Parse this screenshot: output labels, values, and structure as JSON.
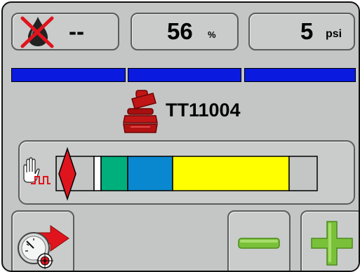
{
  "flow_tile": {
    "value": "--",
    "icon": "no-flow-drop-icon"
  },
  "percent_tile": {
    "value": "56",
    "unit": "%"
  },
  "pressure_tile": {
    "value": "5",
    "unit": "psi"
  },
  "status_bars": [
    "boom-section-1",
    "boom-section-2",
    "boom-section-3"
  ],
  "nozzle": {
    "icon": "nozzle-icon",
    "name": "TT11004"
  },
  "scale": {
    "left_icon": "manual-hand-pulse-icon",
    "marker_icon": "red-diamond-marker",
    "segment_colors": [
      "#c3c6c5",
      "#ffffff",
      "#00b07c",
      "#0a88cf",
      "#ffff00",
      "#c3c6c5"
    ]
  },
  "buttons": {
    "calibrate_icon": "gauge-arrow-target-icon",
    "minus_icon": "minus-icon",
    "plus_icon": "plus-icon"
  },
  "colors": {
    "status_bar": "#0a1adf",
    "nozzle": "#b30d0d",
    "plus_minus": "#7ac13a",
    "marker": "#e0141d"
  }
}
